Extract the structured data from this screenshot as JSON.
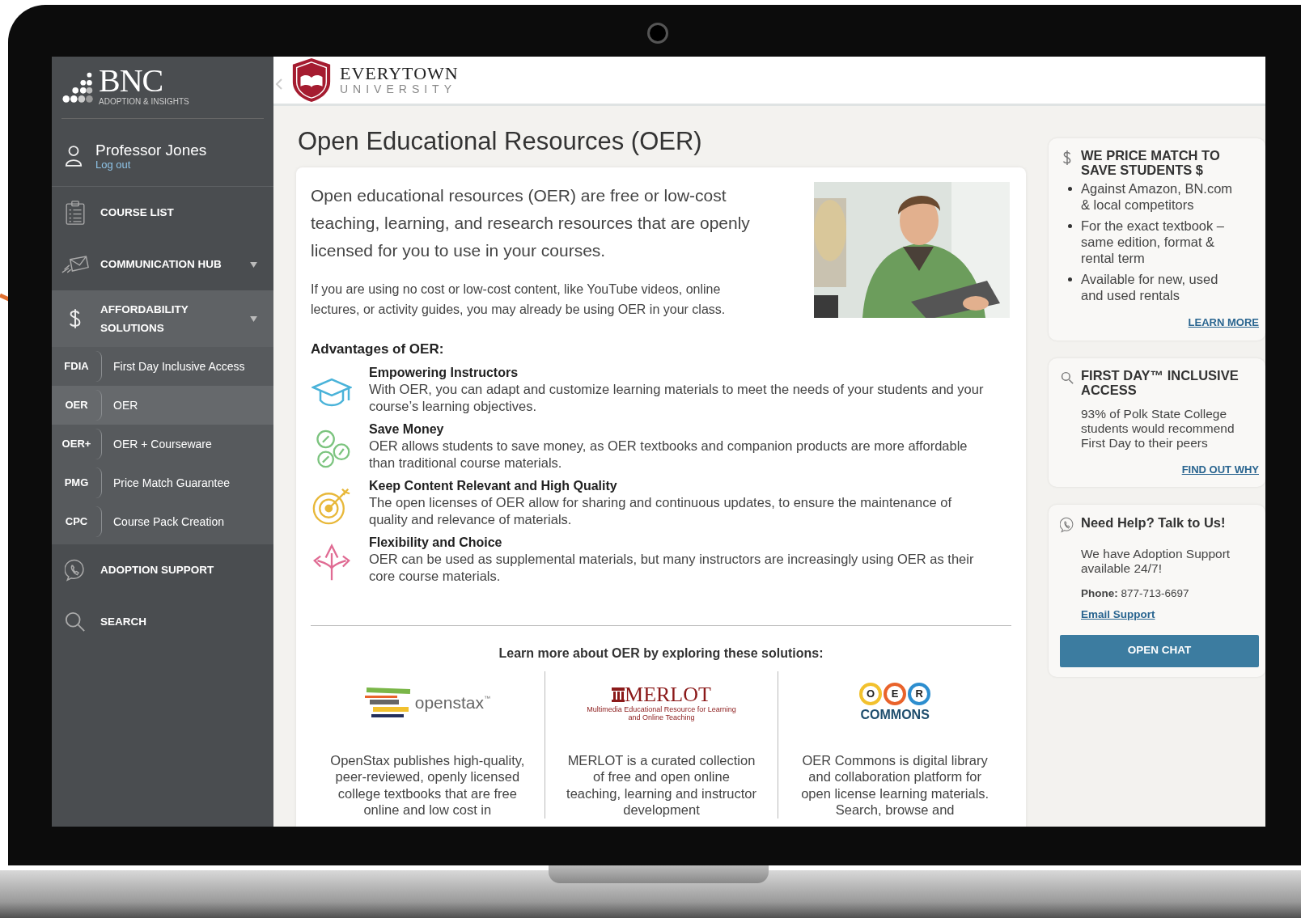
{
  "sidebar": {
    "logo": {
      "mark": "BNC",
      "tagline": "ADOPTION & INSIGHTS"
    },
    "user": {
      "name": "Professor Jones",
      "link": "Log out"
    },
    "nav": [
      {
        "label": "COURSE LIST",
        "expandable": false,
        "expanded": false
      },
      {
        "label": "COMMUNICATION HUB",
        "expandable": true,
        "expanded": false
      },
      {
        "label": "AFFORDABILITY SOLUTIONS",
        "expandable": true,
        "expanded": true,
        "children": [
          {
            "abbr": "FDIA",
            "label": "First Day Inclusive Access",
            "selected": false
          },
          {
            "abbr": "OER",
            "label": "OER",
            "selected": true
          },
          {
            "abbr": "OER+",
            "label": "OER + Courseware",
            "selected": false
          },
          {
            "abbr": "PMG",
            "label": "Price Match Guarantee",
            "selected": false
          },
          {
            "abbr": "CPC",
            "label": "Course Pack Creation",
            "selected": false
          }
        ]
      },
      {
        "label": "ADOPTION SUPPORT",
        "expandable": false,
        "expanded": false
      },
      {
        "label": "SEARCH",
        "expandable": false,
        "expanded": false
      }
    ]
  },
  "header": {
    "logo": {
      "name": "EVERYTOWN",
      "subtitle": "UNIVERSITY"
    }
  },
  "page_title": "Open Educational Resources (OER)",
  "intro": {
    "lead": "Open educational resources (OER) are free or low-cost teaching, learning, and research resources that are openly licensed for you to use in your courses.",
    "body": "If you are using no cost or low-cost content, like YouTube videos, online lectures, or activity guides, you may already be using OER in your class."
  },
  "advantages": {
    "heading": "Advantages of OER:",
    "items": [
      {
        "title": "Empowering Instructors",
        "text": "With OER, you can adapt and customize learning materials to meet the needs of your students and your course’s learning objectives."
      },
      {
        "title": "Save Money",
        "text": "OER allows students to save money, as OER textbooks and companion products are more affordable than traditional course materials."
      },
      {
        "title": "Keep Content Relevant and High Quality",
        "text": "The open licenses of OER allow for sharing and continuous updates, to ensure the maintenance of quality and relevance of materials."
      },
      {
        "title": "Flexibility and Choice",
        "text": "OER can be used as supplemental materials, but many instructors are increasingly using OER as their core course materials."
      }
    ]
  },
  "solutions": {
    "heading": "Learn more about OER by exploring these solutions:",
    "items": [
      {
        "logo_text": [
          "openstax",
          "™"
        ],
        "text": "OpenStax publishes high-quality, peer-reviewed, openly licensed college textbooks that are free online and low cost in"
      },
      {
        "logo_text": [
          "MERLOT",
          "Multimedia Educational Resource for Learning and Online Teaching"
        ],
        "text": "MERLOT is a curated collection of free and open online teaching, learning and instructor development"
      },
      {
        "logo_text": [
          "O",
          "E",
          "R",
          "COMMONS"
        ],
        "text": "OER Commons is digital library and collaboration platform for open license learning materials. Search, browse and"
      }
    ]
  },
  "aside": [
    {
      "kind": "bullets",
      "title": "WE PRICE MATCH TO SAVE STUDENTS $",
      "items": [
        "Against Amazon, BN.com & local competitors",
        "For the exact textbook – same edition, format & rental term",
        "Available for new, used and used rentals"
      ],
      "link": "LEARN MORE"
    },
    {
      "kind": "text",
      "title": "FIRST DAY™ INCLUSIVE ACCESS",
      "text": "93% of Polk State College students would recommend First Day to their peers",
      "link": "FIND OUT WHY"
    },
    {
      "kind": "contact",
      "title": "Need Help? Talk to Us!",
      "text": "We have Adoption Support available 24/7!",
      "phone": "**Phone:** 877-713-6697",
      "link": "Email Support",
      "button": "OPEN CHAT"
    }
  ]
}
